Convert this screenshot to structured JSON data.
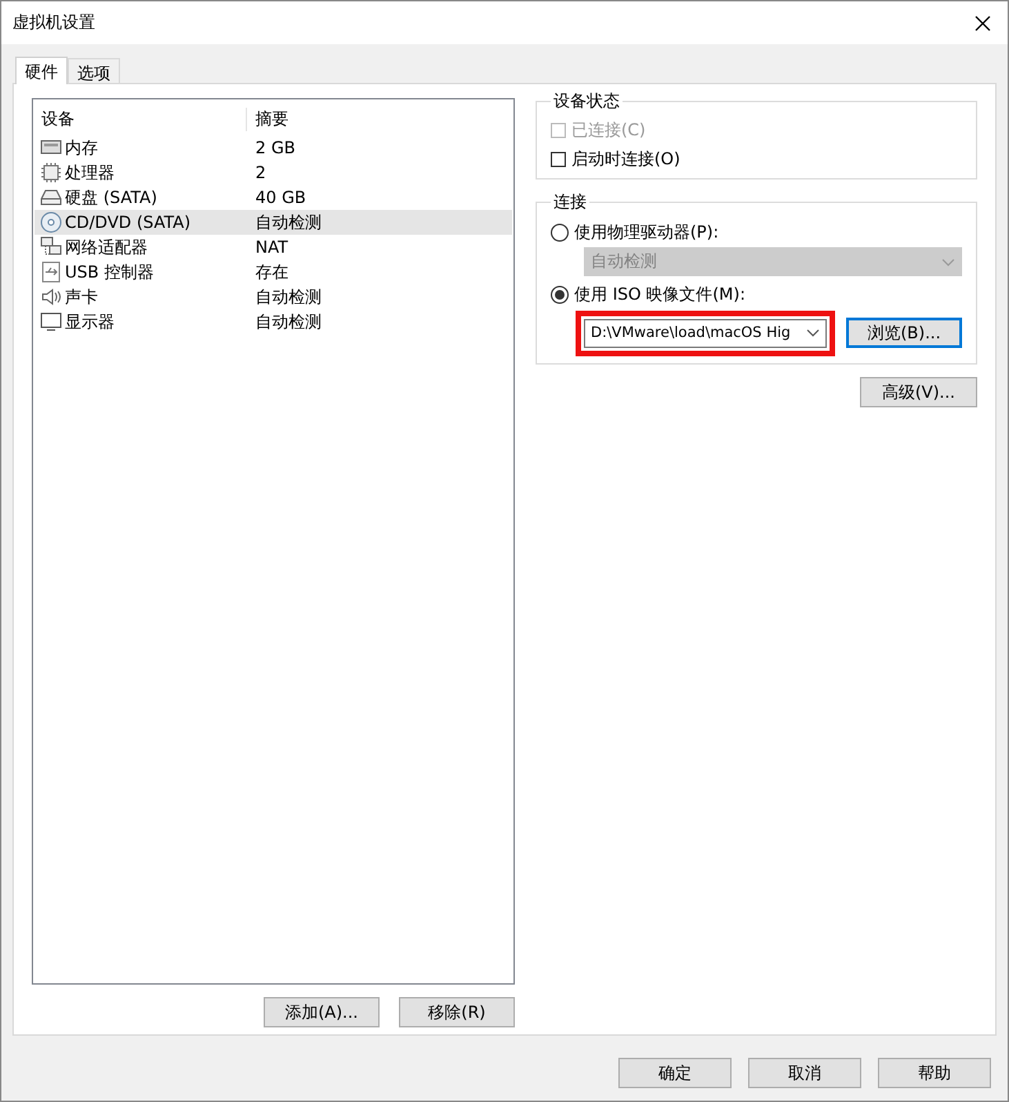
{
  "window": {
    "title": "虚拟机设置"
  },
  "tabs": [
    {
      "label": "硬件",
      "selected": true
    },
    {
      "label": "选项",
      "selected": false
    }
  ],
  "devices": {
    "columns": [
      "设备",
      "摘要"
    ],
    "rows": [
      {
        "kind": "memory",
        "name": "内存",
        "summary": "2 GB",
        "selected": false
      },
      {
        "kind": "cpu",
        "name": "处理器",
        "summary": "2",
        "selected": false
      },
      {
        "kind": "disk",
        "name": "硬盘 (SATA)",
        "summary": "40 GB",
        "selected": false
      },
      {
        "kind": "cd",
        "name": "CD/DVD (SATA)",
        "summary": "自动检测",
        "selected": true
      },
      {
        "kind": "network",
        "name": "网络适配器",
        "summary": "NAT",
        "selected": false
      },
      {
        "kind": "usb",
        "name": "USB 控制器",
        "summary": "存在",
        "selected": false
      },
      {
        "kind": "sound",
        "name": "声卡",
        "summary": "自动检测",
        "selected": false
      },
      {
        "kind": "display",
        "name": "显示器",
        "summary": "自动检测",
        "selected": false
      }
    ]
  },
  "add_button": "添加(A)...",
  "remove_button": "移除(R)",
  "device_status": {
    "title": "设备状态",
    "checkboxes": [
      {
        "label": "已连接(C)",
        "checked": false,
        "disabled": true
      },
      {
        "label": "启动时连接(O)",
        "checked": false,
        "disabled": false
      }
    ]
  },
  "connection": {
    "title": "连接",
    "physical_drive": {
      "label": "使用物理驱动器(P):",
      "selected": false,
      "value": "自动检测",
      "disabled": true
    },
    "iso_file": {
      "label": "使用 ISO 映像文件(M):",
      "selected": true,
      "path": "D:\\VMware\\load\\macOS Hig",
      "highlighted": true,
      "browse_button": "浏览(B)...",
      "browse_focused": true
    }
  },
  "advanced_button": "高级(V)...",
  "footer_buttons": [
    "确定",
    "取消",
    "帮助"
  ]
}
